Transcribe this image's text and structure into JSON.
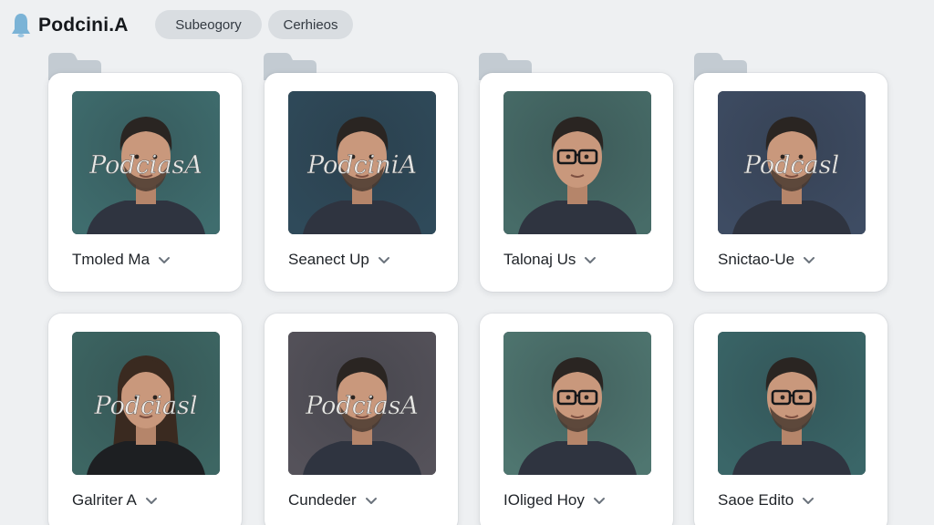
{
  "header": {
    "logo_icon": "bell-icon",
    "app_title": "Podcini.A",
    "chips": [
      {
        "label": "Subeogory"
      },
      {
        "label": "Cerhieos"
      }
    ]
  },
  "colors": {
    "background": "#eef0f2",
    "card": "#ffffff",
    "chip": "#d9dde1",
    "logo": "#7bb3d6",
    "folder_tab": "#c3cbd2"
  },
  "cards": [
    {
      "label": "Tmoled Ma",
      "overlay_text": "PodciasA",
      "person": "man with beard",
      "bg": "#3f6d6e"
    },
    {
      "label": "Seanect Up",
      "overlay_text": "PodciniA",
      "person": "man with beard",
      "bg": "#2f4a5a"
    },
    {
      "label": "Talonaj Us",
      "overlay_text": "",
      "person": "person with glasses",
      "bg": "#476c68"
    },
    {
      "label": "Snictao-Ue",
      "overlay_text": "Podcasl",
      "person": "man with beard",
      "bg": "#3e4c63"
    },
    {
      "label": "Galriter A",
      "overlay_text": "Podciasl",
      "person": "woman with long hair",
      "bg": "#3d6663"
    },
    {
      "label": "Cundeder",
      "overlay_text": "PodciasA",
      "person": "man with beard",
      "bg": "#55525a"
    },
    {
      "label": "IOliged Hoy",
      "overlay_text": "",
      "person": "man with glasses and beard",
      "bg": "#4f7670"
    },
    {
      "label": "Saoe Edito",
      "overlay_text": "",
      "person": "man with glasses and beard",
      "bg": "#3a6668"
    }
  ],
  "card_footer_icon": "chevron-down-icon",
  "folder_icon": "folder-tab-icon"
}
